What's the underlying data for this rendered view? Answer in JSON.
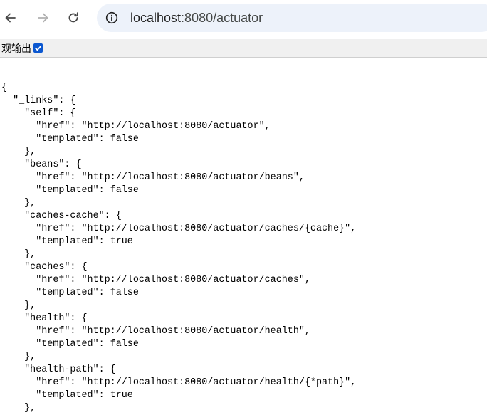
{
  "browser": {
    "url_host": "localhost",
    "url_rest": ":8080/actuator",
    "icons": {
      "back": "back-arrow-icon",
      "forward": "forward-arrow-icon",
      "reload": "reload-icon",
      "site_info": "site-info-icon"
    }
  },
  "pretty_print": {
    "label": "观输出",
    "checked": true
  },
  "json_lines": [
    "{",
    "  \"_links\": {",
    "    \"self\": {",
    "      \"href\": \"http://localhost:8080/actuator\",",
    "      \"templated\": false",
    "    },",
    "    \"beans\": {",
    "      \"href\": \"http://localhost:8080/actuator/beans\",",
    "      \"templated\": false",
    "    },",
    "    \"caches-cache\": {",
    "      \"href\": \"http://localhost:8080/actuator/caches/{cache}\",",
    "      \"templated\": true",
    "    },",
    "    \"caches\": {",
    "      \"href\": \"http://localhost:8080/actuator/caches\",",
    "      \"templated\": false",
    "    },",
    "    \"health\": {",
    "      \"href\": \"http://localhost:8080/actuator/health\",",
    "      \"templated\": false",
    "    },",
    "    \"health-path\": {",
    "      \"href\": \"http://localhost:8080/actuator/health/{*path}\",",
    "      \"templated\": true",
    "    },"
  ]
}
